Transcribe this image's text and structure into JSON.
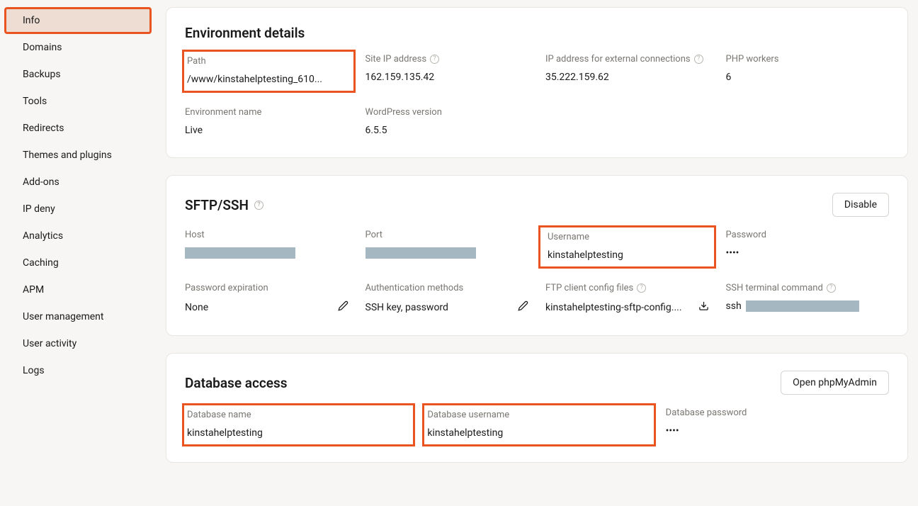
{
  "sidebar": {
    "items": [
      {
        "label": "Info",
        "active": true
      },
      {
        "label": "Domains"
      },
      {
        "label": "Backups"
      },
      {
        "label": "Tools"
      },
      {
        "label": "Redirects"
      },
      {
        "label": "Themes and plugins"
      },
      {
        "label": "Add-ons"
      },
      {
        "label": "IP deny"
      },
      {
        "label": "Analytics"
      },
      {
        "label": "Caching"
      },
      {
        "label": "APM"
      },
      {
        "label": "User management"
      },
      {
        "label": "User activity"
      },
      {
        "label": "Logs"
      }
    ]
  },
  "env": {
    "title": "Environment details",
    "path_label": "Path",
    "path_value": "/www/kinstahelptesting_610...",
    "site_ip_label": "Site IP address",
    "site_ip_value": "162.159.135.42",
    "ext_ip_label": "IP address for external connections",
    "ext_ip_value": "35.222.159.62",
    "php_label": "PHP workers",
    "php_value": "6",
    "env_name_label": "Environment name",
    "env_name_value": "Live",
    "wp_label": "WordPress version",
    "wp_value": "6.5.5"
  },
  "sftp": {
    "title": "SFTP/SSH",
    "disable": "Disable",
    "host_label": "Host",
    "port_label": "Port",
    "user_label": "Username",
    "user_value": "kinstahelptesting",
    "pass_label": "Password",
    "pass_value": "••••",
    "expiry_label": "Password expiration",
    "expiry_value": "None",
    "auth_label": "Authentication methods",
    "auth_value": "SSH key, password",
    "ftp_label": "FTP client config files",
    "ftp_value": "kinstahelptesting-sftp-config....",
    "ssh_label": "SSH terminal command",
    "ssh_prefix": "ssh"
  },
  "db": {
    "title": "Database access",
    "open": "Open phpMyAdmin",
    "name_label": "Database name",
    "name_value": "kinstahelptesting",
    "user_label": "Database username",
    "user_value": "kinstahelptesting",
    "pass_label": "Database password",
    "pass_value": "••••"
  }
}
